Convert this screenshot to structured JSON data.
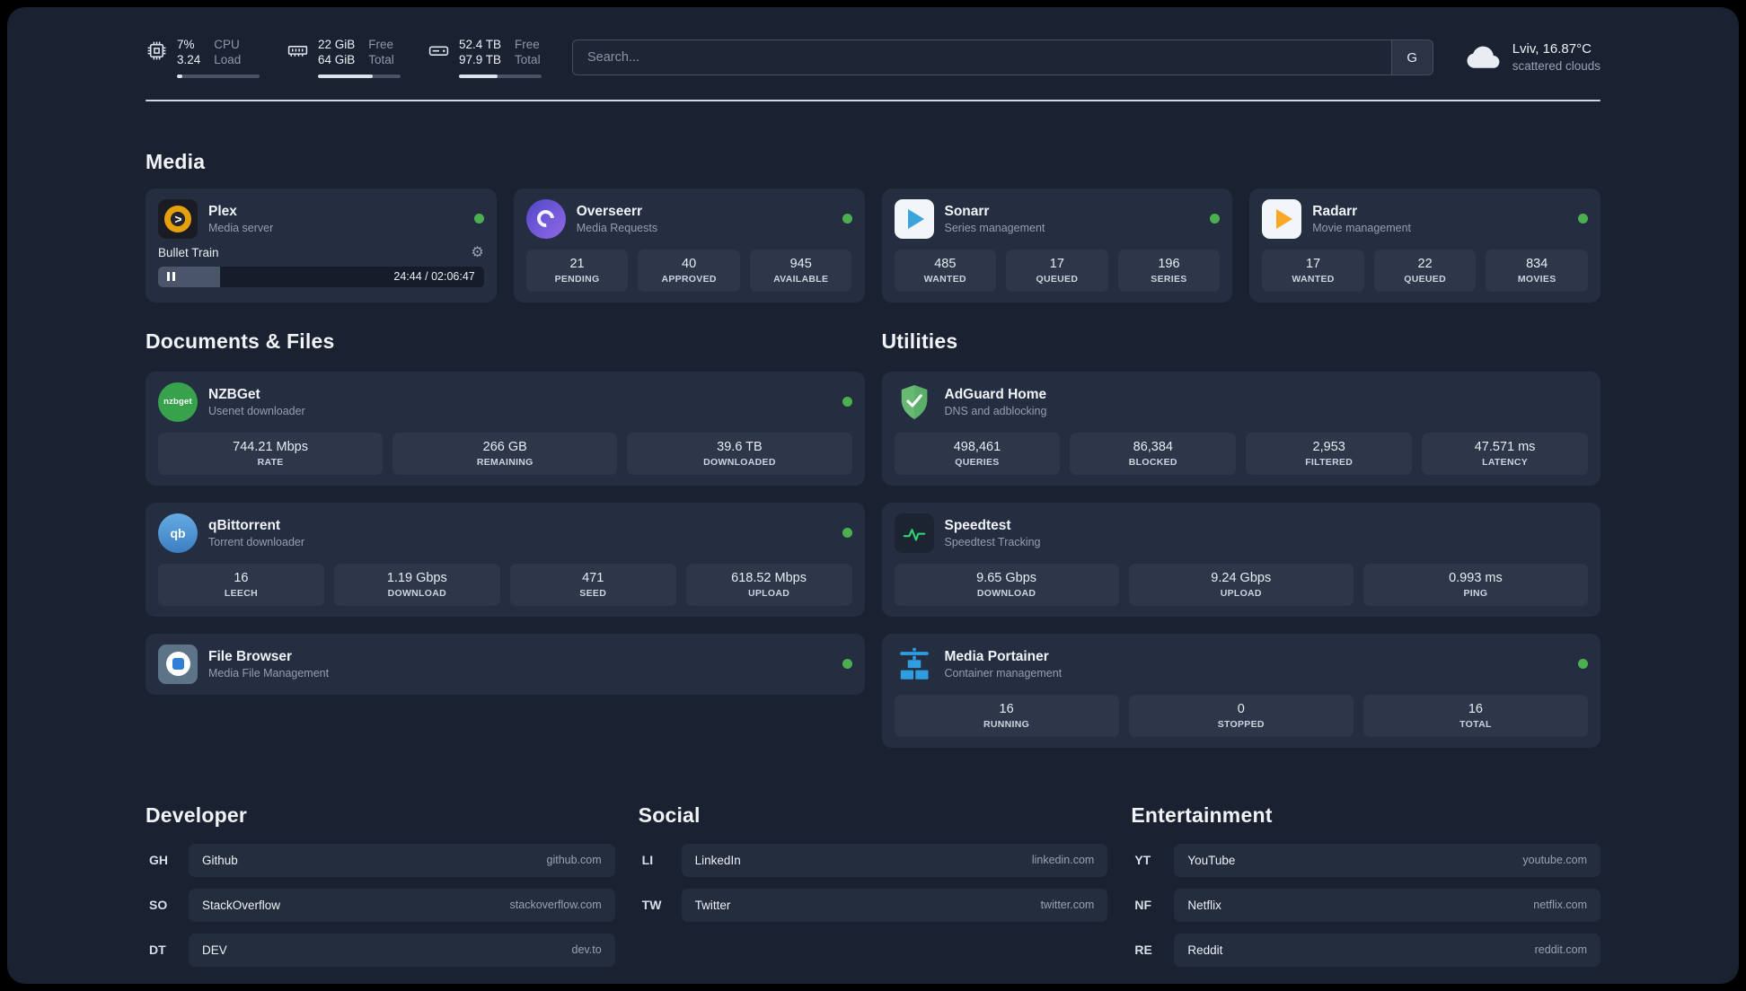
{
  "colors": {
    "status_online": "#4caf50"
  },
  "topbar": {
    "metrics": [
      {
        "icon": "cpu-icon",
        "primary": "7%",
        "secondary": "3.24",
        "label_primary": "CPU",
        "label_secondary": "Load",
        "progress_percent": 7
      },
      {
        "icon": "ram-icon",
        "primary": "22 GiB",
        "secondary": "64 GiB",
        "label_primary": "Free",
        "label_secondary": "Total",
        "progress_percent": 66
      },
      {
        "icon": "disk-icon",
        "primary": "52.4 TB",
        "secondary": "97.9 TB",
        "label_primary": "Free",
        "label_secondary": "Total",
        "progress_percent": 47
      }
    ],
    "search": {
      "placeholder": "Search...",
      "engine_button": "G"
    },
    "weather": {
      "location": "Lviv, 16.87°C",
      "condition": "scattered clouds"
    }
  },
  "sections": {
    "media": {
      "title": "Media",
      "apps": [
        {
          "name": "Plex",
          "subtitle": "Media server",
          "online": true,
          "player": {
            "track": "Bullet Train",
            "time": "24:44 / 02:06:47",
            "progress_percent": 19
          }
        },
        {
          "name": "Overseerr",
          "subtitle": "Media Requests",
          "online": true,
          "stats": [
            {
              "value": "21",
              "label": "PENDING"
            },
            {
              "value": "40",
              "label": "APPROVED"
            },
            {
              "value": "945",
              "label": "AVAILABLE"
            }
          ]
        },
        {
          "name": "Sonarr",
          "subtitle": "Series management",
          "online": true,
          "stats": [
            {
              "value": "485",
              "label": "WANTED"
            },
            {
              "value": "17",
              "label": "QUEUED"
            },
            {
              "value": "196",
              "label": "SERIES"
            }
          ]
        },
        {
          "name": "Radarr",
          "subtitle": "Movie management",
          "online": true,
          "stats": [
            {
              "value": "17",
              "label": "WANTED"
            },
            {
              "value": "22",
              "label": "QUEUED"
            },
            {
              "value": "834",
              "label": "MOVIES"
            }
          ]
        }
      ]
    },
    "documents": {
      "title": "Documents & Files",
      "apps": [
        {
          "name": "NZBGet",
          "subtitle": "Usenet downloader",
          "online": true,
          "icon_text": "nzbget",
          "stats": [
            {
              "value": "744.21 Mbps",
              "label": "RATE"
            },
            {
              "value": "266 GB",
              "label": "REMAINING"
            },
            {
              "value": "39.6 TB",
              "label": "DOWNLOADED"
            }
          ]
        },
        {
          "name": "qBittorrent",
          "subtitle": "Torrent downloader",
          "online": true,
          "icon_text": "qb",
          "stats": [
            {
              "value": "16",
              "label": "LEECH"
            },
            {
              "value": "1.19 Gbps",
              "label": "DOWNLOAD"
            },
            {
              "value": "471",
              "label": "SEED"
            },
            {
              "value": "618.52 Mbps",
              "label": "UPLOAD"
            }
          ]
        },
        {
          "name": "File Browser",
          "subtitle": "Media File Management",
          "online": true
        }
      ]
    },
    "utilities": {
      "title": "Utilities",
      "apps": [
        {
          "name": "AdGuard Home",
          "subtitle": "DNS and adblocking",
          "stats": [
            {
              "value": "498,461",
              "label": "QUERIES"
            },
            {
              "value": "86,384",
              "label": "BLOCKED"
            },
            {
              "value": "2,953",
              "label": "FILTERED"
            },
            {
              "value": "47.571 ms",
              "label": "LATENCY"
            }
          ]
        },
        {
          "name": "Speedtest",
          "subtitle": "Speedtest Tracking",
          "stats": [
            {
              "value": "9.65 Gbps",
              "label": "DOWNLOAD"
            },
            {
              "value": "9.24 Gbps",
              "label": "UPLOAD"
            },
            {
              "value": "0.993 ms",
              "label": "PING"
            }
          ]
        },
        {
          "name": "Media Portainer",
          "subtitle": "Container management",
          "online": true,
          "stats": [
            {
              "value": "16",
              "label": "RUNNING"
            },
            {
              "value": "0",
              "label": "STOPPED"
            },
            {
              "value": "16",
              "label": "TOTAL"
            }
          ]
        }
      ]
    },
    "bookmarks": [
      {
        "title": "Developer",
        "items": [
          {
            "abbr": "GH",
            "name": "Github",
            "url": "github.com"
          },
          {
            "abbr": "SO",
            "name": "StackOverflow",
            "url": "stackoverflow.com"
          },
          {
            "abbr": "DT",
            "name": "DEV",
            "url": "dev.to"
          }
        ]
      },
      {
        "title": "Social",
        "items": [
          {
            "abbr": "LI",
            "name": "LinkedIn",
            "url": "linkedin.com"
          },
          {
            "abbr": "TW",
            "name": "Twitter",
            "url": "twitter.com"
          }
        ]
      },
      {
        "title": "Entertainment",
        "items": [
          {
            "abbr": "YT",
            "name": "YouTube",
            "url": "youtube.com"
          },
          {
            "abbr": "NF",
            "name": "Netflix",
            "url": "netflix.com"
          },
          {
            "abbr": "RE",
            "name": "Reddit",
            "url": "reddit.com"
          }
        ]
      }
    ]
  }
}
